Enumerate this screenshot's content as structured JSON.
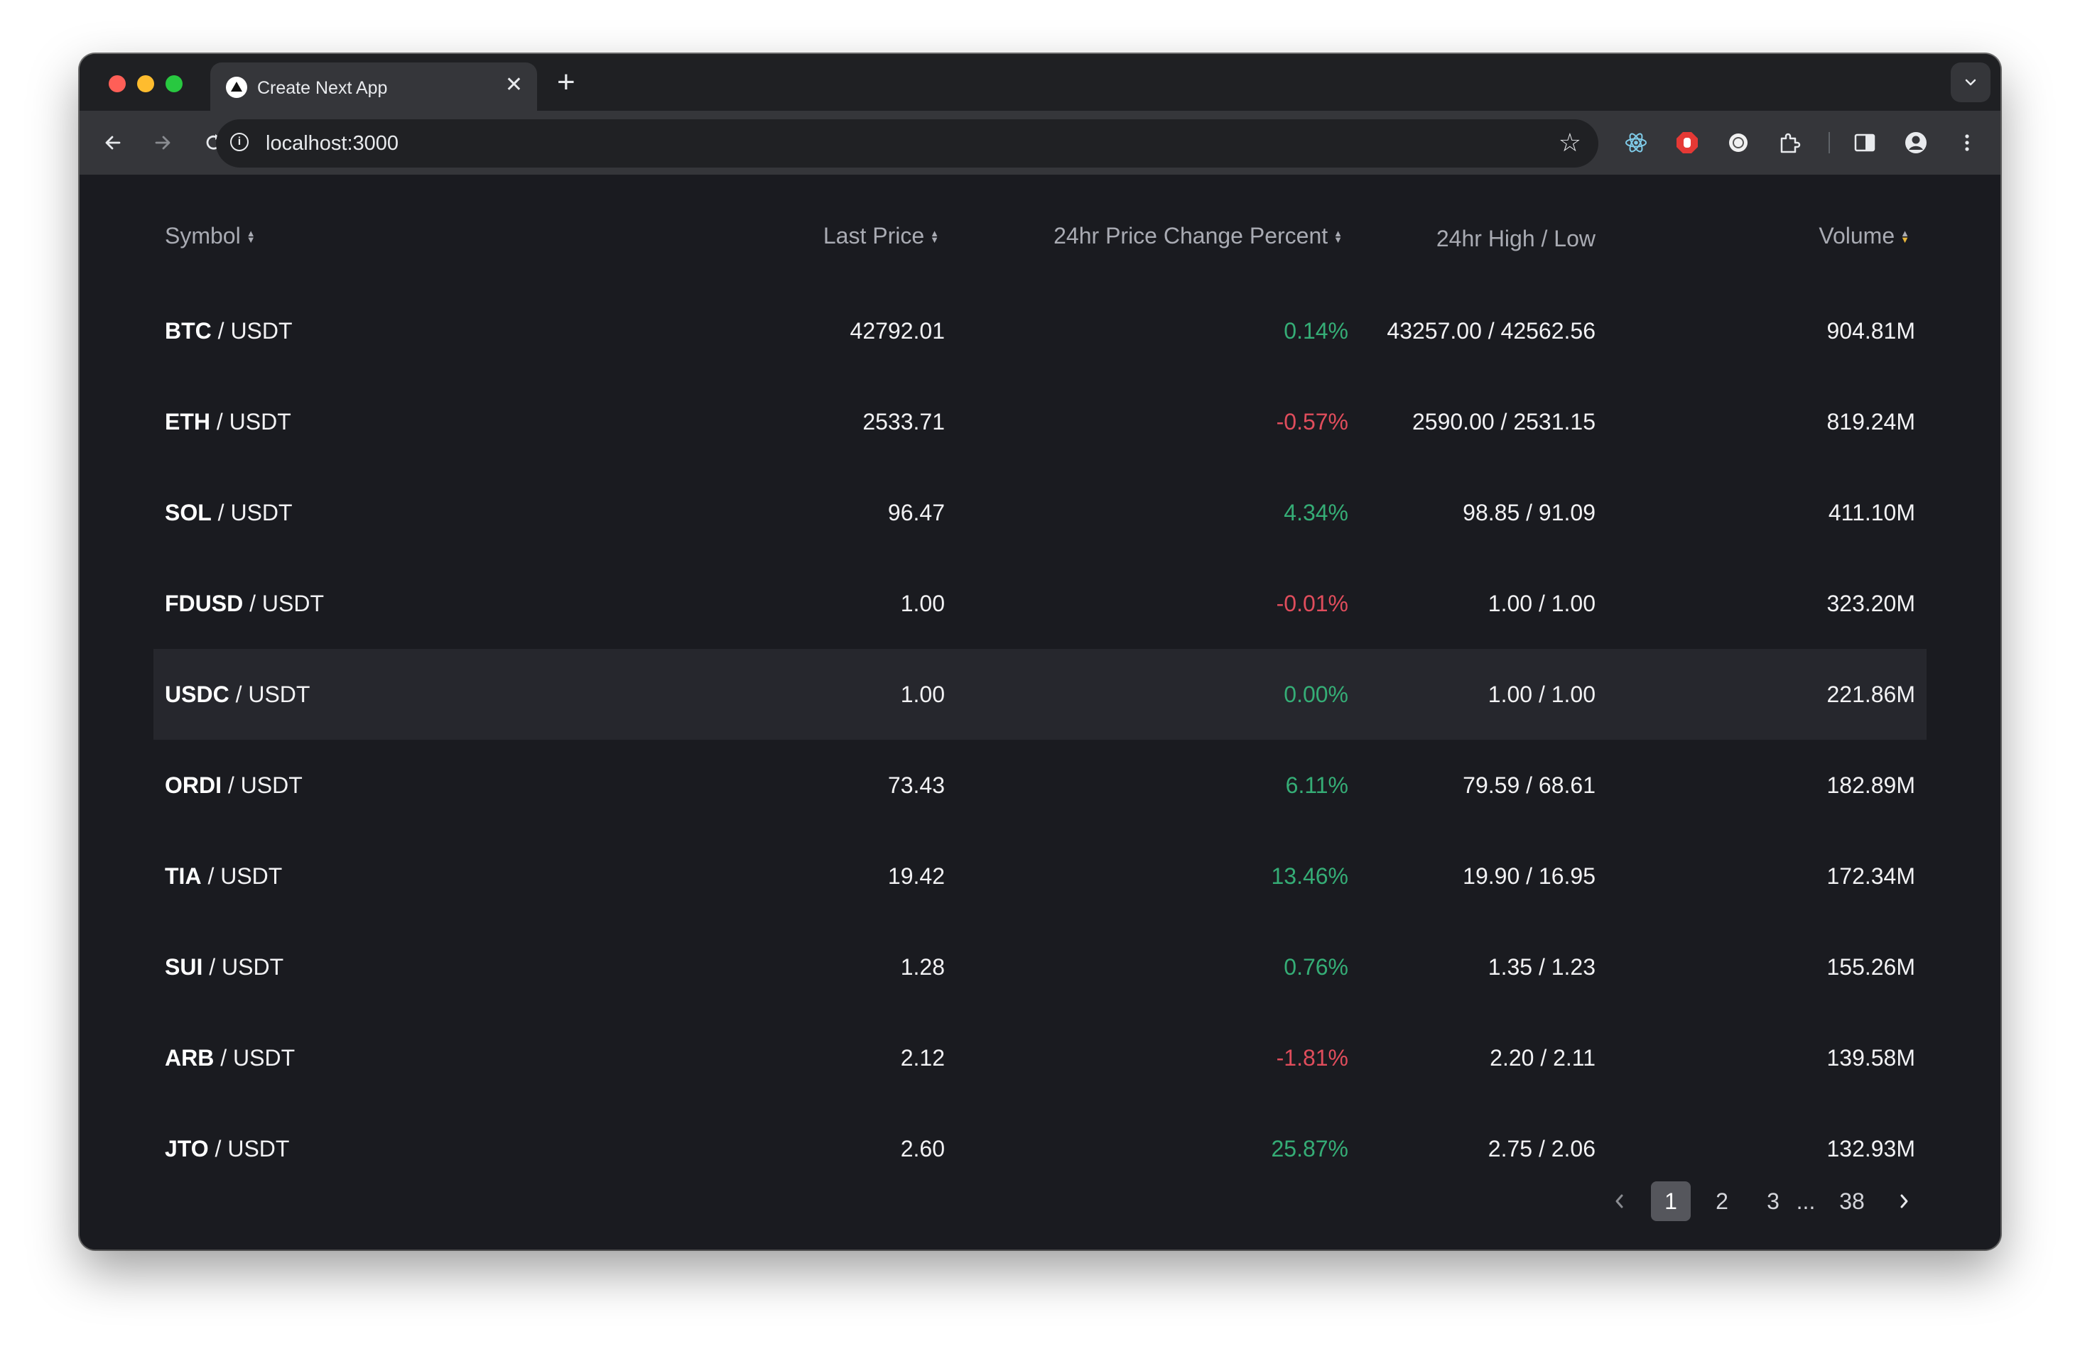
{
  "browser": {
    "tab_title": "Create Next App",
    "url": "localhost:3000"
  },
  "table": {
    "headers": {
      "symbol": "Symbol",
      "last_price": "Last Price",
      "change": "24hr Price Change Percent",
      "high_low": "24hr High / Low",
      "volume": "Volume"
    },
    "sorted_by": "Volume",
    "sort_direction": "descending",
    "rows": [
      {
        "base": "BTC",
        "quote": " / USDT",
        "price": "42792.01",
        "change": "0.14%",
        "trend": "up",
        "high_low": "43257.00 / 42562.56",
        "volume": "904.81M"
      },
      {
        "base": "ETH",
        "quote": " / USDT",
        "price": "2533.71",
        "change": "-0.57%",
        "trend": "down",
        "high_low": "2590.00 / 2531.15",
        "volume": "819.24M"
      },
      {
        "base": "SOL",
        "quote": " / USDT",
        "price": "96.47",
        "change": "4.34%",
        "trend": "up",
        "high_low": "98.85 / 91.09",
        "volume": "411.10M"
      },
      {
        "base": "FDUSD",
        "quote": " / USDT",
        "price": "1.00",
        "change": "-0.01%",
        "trend": "down",
        "high_low": "1.00 / 1.00",
        "volume": "323.20M"
      },
      {
        "base": "USDC",
        "quote": " / USDT",
        "price": "1.00",
        "change": "0.00%",
        "trend": "up",
        "high_low": "1.00 / 1.00",
        "volume": "221.86M"
      },
      {
        "base": "ORDI",
        "quote": " / USDT",
        "price": "73.43",
        "change": "6.11%",
        "trend": "up",
        "high_low": "79.59 / 68.61",
        "volume": "182.89M"
      },
      {
        "base": "TIA",
        "quote": " / USDT",
        "price": "19.42",
        "change": "13.46%",
        "trend": "up",
        "high_low": "19.90 / 16.95",
        "volume": "172.34M"
      },
      {
        "base": "SUI",
        "quote": " / USDT",
        "price": "1.28",
        "change": "0.76%",
        "trend": "up",
        "high_low": "1.35 / 1.23",
        "volume": "155.26M"
      },
      {
        "base": "ARB",
        "quote": " / USDT",
        "price": "2.12",
        "change": "-1.81%",
        "trend": "down",
        "high_low": "2.20 / 2.11",
        "volume": "139.58M"
      },
      {
        "base": "JTO",
        "quote": " / USDT",
        "price": "2.60",
        "change": "25.87%",
        "trend": "up",
        "high_low": "2.75 / 2.06",
        "volume": "132.93M"
      }
    ]
  },
  "pagination": {
    "pages": [
      "1",
      "2",
      "3"
    ],
    "ellipsis": "...",
    "last": "38",
    "current": "1"
  },
  "colors": {
    "background": "#1a1b20",
    "positive": "#35ad76",
    "negative": "#e04d5c",
    "sort_active": "#e7b53a"
  }
}
